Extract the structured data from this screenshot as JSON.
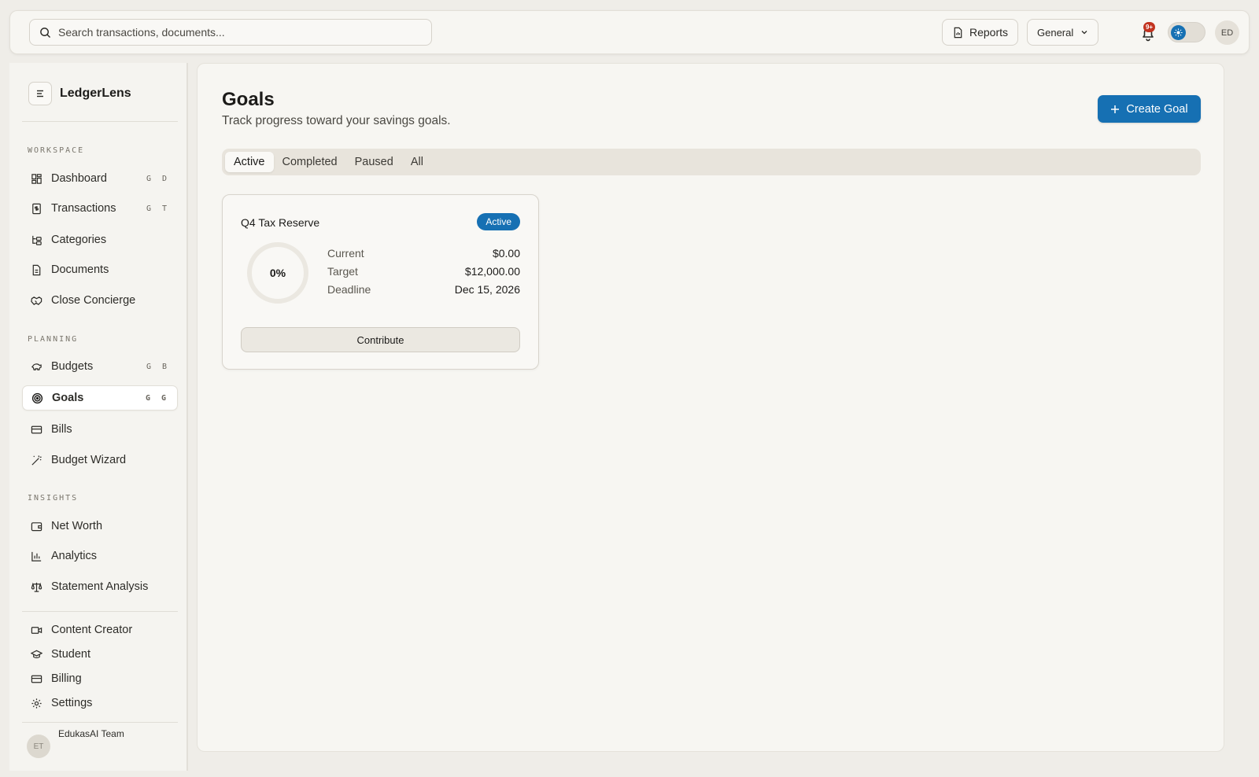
{
  "header": {
    "search_placeholder": "Search transactions, documents...",
    "reports_label": "Reports",
    "workspace_select": "General",
    "notification_count": "9+",
    "user_initials": "ED"
  },
  "sidebar": {
    "brand": "LedgerLens",
    "sections": {
      "workspace": "WORKSPACE",
      "planning": "PLANNING",
      "insights": "INSIGHTS"
    },
    "items": [
      {
        "label": "Dashboard",
        "shortcut": "G D",
        "icon": "dashboard-icon"
      },
      {
        "label": "Transactions",
        "shortcut": "G T",
        "icon": "receipt-icon"
      },
      {
        "label": "Categories",
        "shortcut": "",
        "icon": "tree-icon"
      },
      {
        "label": "Documents",
        "shortcut": "",
        "icon": "document-icon"
      },
      {
        "label": "Close Concierge",
        "shortcut": "",
        "icon": "handshake-icon"
      },
      {
        "label": "Budgets",
        "shortcut": "G B",
        "icon": "piggy-bank-icon"
      },
      {
        "label": "Goals",
        "shortcut": "G G",
        "icon": "target-icon"
      },
      {
        "label": "Bills",
        "shortcut": "",
        "icon": "card-icon"
      },
      {
        "label": "Budget Wizard",
        "shortcut": "",
        "icon": "wand-icon"
      },
      {
        "label": "Net Worth",
        "shortcut": "",
        "icon": "wallet-icon"
      },
      {
        "label": "Analytics",
        "shortcut": "",
        "icon": "bar-chart-icon"
      },
      {
        "label": "Statement Analysis",
        "shortcut": "",
        "icon": "scale-icon"
      },
      {
        "label": "Content Creator",
        "shortcut": "",
        "icon": "video-icon"
      },
      {
        "label": "Student",
        "shortcut": "",
        "icon": "graduation-cap-icon"
      },
      {
        "label": "Billing",
        "shortcut": "",
        "icon": "credit-card-icon"
      },
      {
        "label": "Settings",
        "shortcut": "",
        "icon": "gear-icon"
      }
    ],
    "footer_user": "EdukasAI Team",
    "footer_initials": "ET"
  },
  "main": {
    "title": "Goals",
    "subtitle": "Track progress toward your savings goals.",
    "create_label": "Create Goal",
    "tabs": [
      "Active",
      "Completed",
      "Paused",
      "All"
    ],
    "active_tab": "Active",
    "goal": {
      "name": "Q4 Tax Reserve",
      "status": "Active",
      "progress_label": "0%",
      "progress": 0,
      "rows": [
        {
          "label": "Current",
          "value": "$0.00"
        },
        {
          "label": "Target",
          "value": "$12,000.00"
        },
        {
          "label": "Deadline",
          "value": "Dec 15, 2026"
        }
      ],
      "contribute_label": "Contribute"
    }
  },
  "colors": {
    "accent": "#1670b3",
    "notification": "#c2331f",
    "background": "#efede8"
  }
}
